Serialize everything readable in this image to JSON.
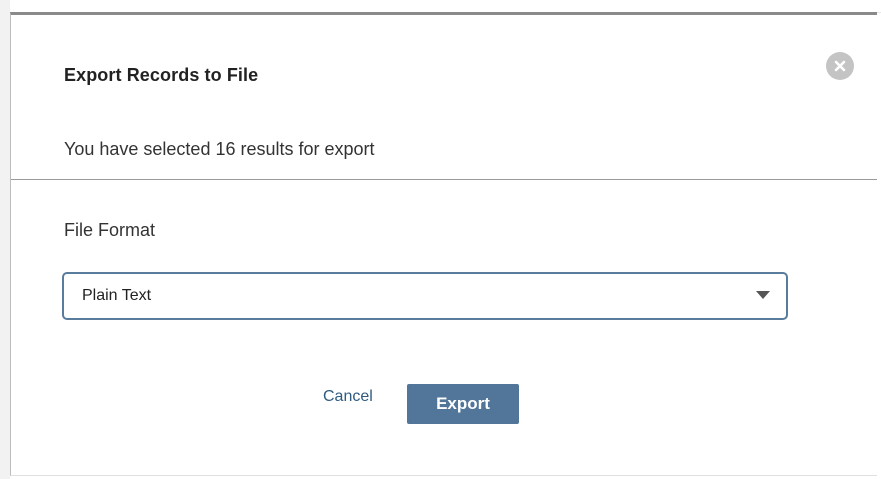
{
  "dialog": {
    "title": "Export Records to File",
    "subtitle": "You have selected 16 results for export",
    "close_icon": "close-icon"
  },
  "file_format": {
    "label": "File Format",
    "selected": "Plain Text",
    "caret_icon": "chevron-down-icon"
  },
  "actions": {
    "cancel_label": "Cancel",
    "export_label": "Export"
  },
  "colors": {
    "primary": "#51769a",
    "link": "#2f5b80",
    "select_border": "#5a7c9c",
    "close_bg": "#c4c4c4"
  }
}
